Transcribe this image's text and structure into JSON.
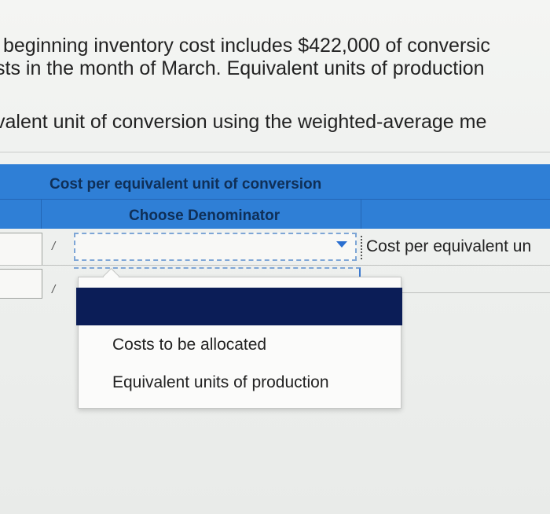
{
  "question": {
    "line1": "beginning inventory cost includes $422,000 of conversic",
    "line2": "sts in the month of March. Equivalent units of production",
    "line3": "valent unit of conversion using the weighted-average me"
  },
  "table": {
    "title": "Cost per equivalent unit of conversion",
    "subheader": "Choose Denominator",
    "divider_symbol": "/",
    "row1_result_label": "Cost per equivalent un"
  },
  "dropdown": {
    "selected_value": "",
    "options": [
      {
        "label": ""
      },
      {
        "label": "Costs to be allocated"
      },
      {
        "label": "Equivalent units of production"
      }
    ]
  },
  "colors": {
    "header_blue": "#2f7fd6",
    "selected_option": "#0b1d57",
    "focus_outline": "#7ea6d6"
  }
}
